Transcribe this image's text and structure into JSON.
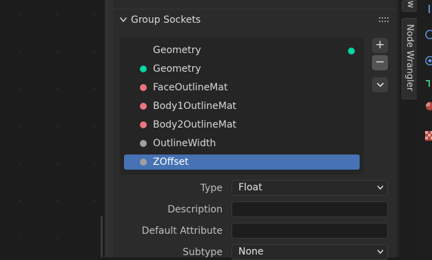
{
  "panel": {
    "title": "Group Sockets"
  },
  "sockets": [
    {
      "label": "Geometry",
      "kind": "output",
      "color": "#00d6a3",
      "selected": false
    },
    {
      "label": "Geometry",
      "kind": "input",
      "color": "#00d6a3",
      "selected": false
    },
    {
      "label": "FaceOutlineMat",
      "kind": "input",
      "color": "#eb7582",
      "selected": false
    },
    {
      "label": "Body1OutlineMat",
      "kind": "input",
      "color": "#eb7582",
      "selected": false
    },
    {
      "label": "Body2OutlineMat",
      "kind": "input",
      "color": "#eb7582",
      "selected": false
    },
    {
      "label": "OutlineWidth",
      "kind": "input",
      "color": "#a1a1a1",
      "selected": false
    },
    {
      "label": "ZOffset",
      "kind": "input",
      "color": "#a1a1a1",
      "selected": true
    }
  ],
  "side_buttons": {
    "add": "+",
    "remove": "−"
  },
  "properties": {
    "type_label": "Type",
    "type_value": "Float",
    "description_label": "Description",
    "description_value": "",
    "default_attribute_label": "Default Attribute",
    "default_attribute_value": "",
    "subtype_label": "Subtype",
    "subtype_value": "None"
  },
  "tabs": {
    "partial_tab": "w",
    "node_wrangler": "Node Wrangler"
  },
  "colors": {
    "selection": "#4772b3",
    "geometry_socket": "#00d6a3",
    "material_socket": "#eb7582",
    "float_socket": "#a1a1a1"
  }
}
